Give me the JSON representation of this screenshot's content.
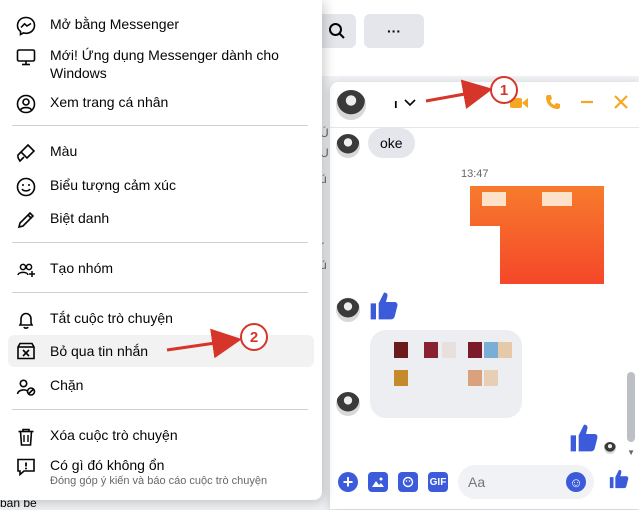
{
  "background": {
    "more_button_label": "···",
    "bottom_left_text": "ban bè",
    "side_fragments": [
      "Ú",
      "U",
      "ú",
      "r",
      "ú"
    ]
  },
  "menu": {
    "items": [
      {
        "label": "Mở bằng Messenger",
        "icon": "messenger-icon"
      },
      {
        "label": "Mới! Ứng dụng Messenger dành cho Windows",
        "icon": "monitor-icon"
      },
      {
        "label": "Xem trang cá nhân",
        "icon": "user-circle-icon"
      },
      {
        "label": "Màu",
        "icon": "paint-brush-icon"
      },
      {
        "label": "Biểu tượng cảm xúc",
        "icon": "smiley-icon"
      },
      {
        "label": "Biệt danh",
        "icon": "pencil-icon"
      },
      {
        "label": "Tạo nhóm",
        "icon": "group-add-icon"
      },
      {
        "label": "Tắt cuộc trò chuyện",
        "icon": "bell-icon"
      },
      {
        "label": "Bỏ qua tin nhắn",
        "icon": "ignore-box-icon"
      },
      {
        "label": "Chặn",
        "icon": "block-user-icon"
      },
      {
        "label": "Xóa cuộc trò chuyện",
        "icon": "trash-icon"
      },
      {
        "label": "Có gì đó không ổn",
        "icon": "report-icon",
        "sublabel": "Đóng góp ý kiến và báo cáo cuộc trò chuyện"
      }
    ]
  },
  "chat": {
    "name": "ı",
    "message_text": "oke",
    "timestamp": "13:47",
    "input_placeholder": "Aa",
    "accent_color": "#f5a623",
    "like_color": "#3b5bdb",
    "gif_label": "GIF"
  },
  "annotations": {
    "marker_1": "1",
    "marker_2": "2",
    "arrow_color": "#d6362a"
  }
}
